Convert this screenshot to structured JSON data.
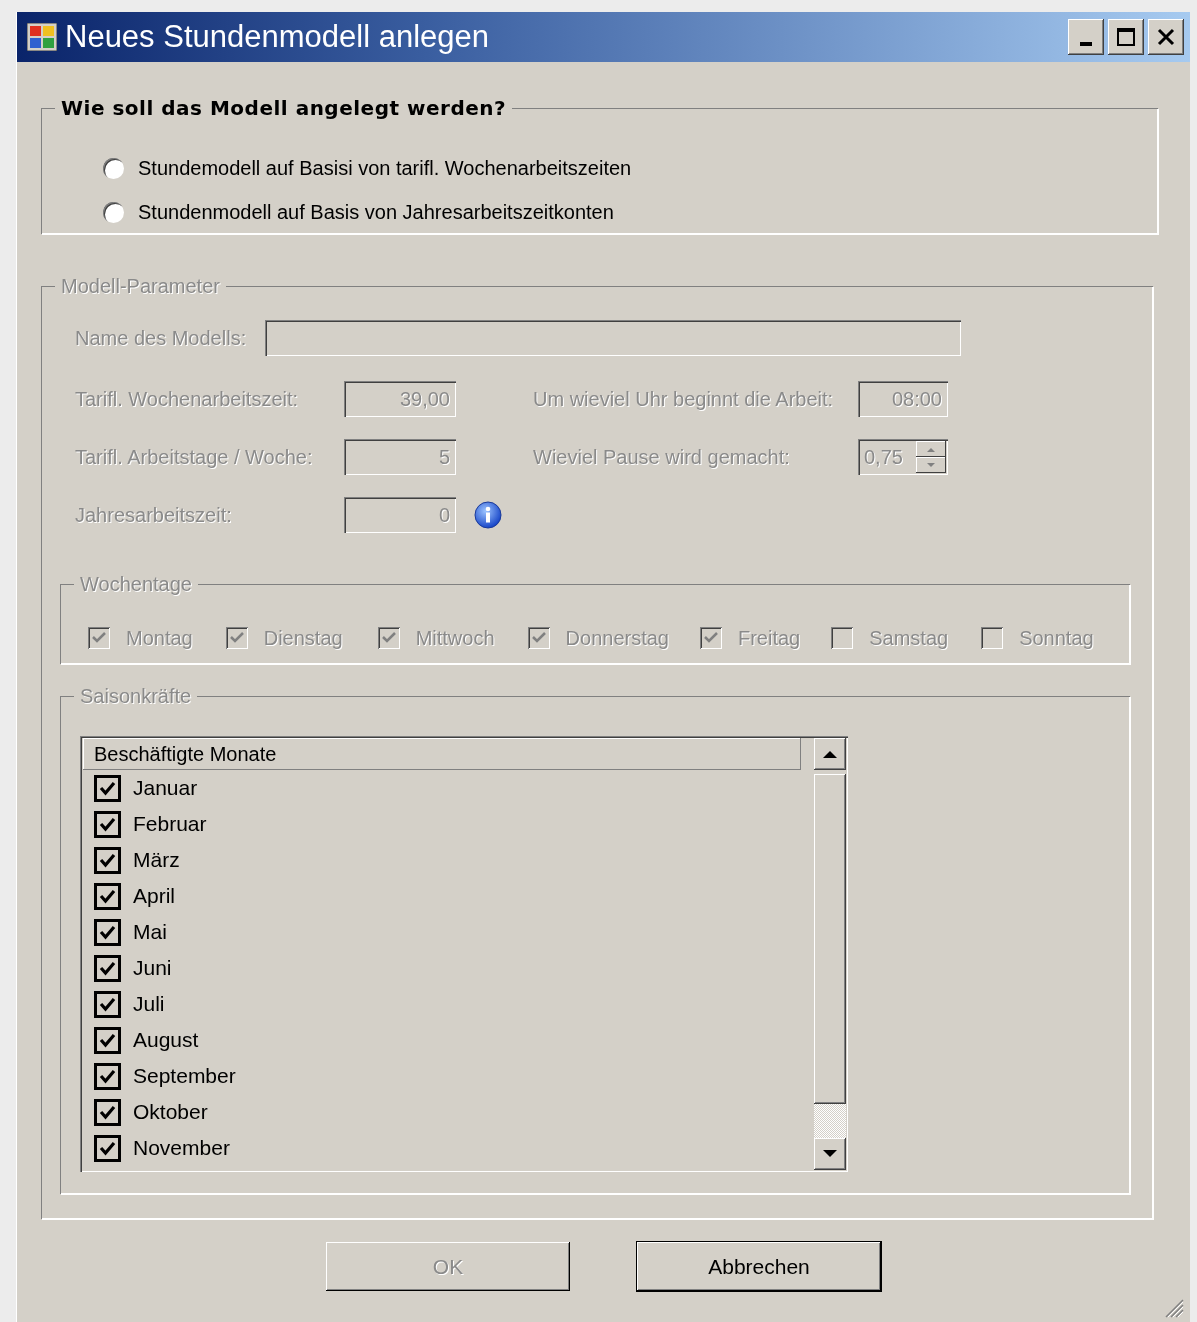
{
  "window": {
    "title": "Neues Stundenmodell anlegen"
  },
  "mode_group": {
    "title": "Wie soll das Modell angelegt werden?",
    "options": [
      {
        "label": "Stundemodell auf Basisi von tarifl. Wochenarbeitszeiten",
        "selected": false
      },
      {
        "label": "Stundenmodell auf Basis von Jahresarbeitszeitkonten",
        "selected": false
      }
    ]
  },
  "parameters": {
    "title": "Modell-Parameter",
    "disabled": true,
    "name_field": {
      "label": "Name des Modells:"
    },
    "weekly_hours": {
      "label": "Tarifl. Wochenarbeitszeit:",
      "value": "39,00"
    },
    "start_time": {
      "label": "Um wieviel Uhr beginnt die Arbeit:",
      "value": "08:00"
    },
    "work_days": {
      "label": "Tarifl. Arbeitstage / Woche:",
      "value": "5"
    },
    "break_time": {
      "label": "Wieviel Pause wird gemacht:",
      "value": "0,75"
    },
    "annual_hours": {
      "label": "Jahresarbeitszeit:",
      "value": "0"
    },
    "weekdays": {
      "title": "Wochentage",
      "days": [
        {
          "label": "Montag",
          "checked": true
        },
        {
          "label": "Dienstag",
          "checked": true
        },
        {
          "label": "Mittwoch",
          "checked": true
        },
        {
          "label": "Donnerstag",
          "checked": true
        },
        {
          "label": "Freitag",
          "checked": true
        },
        {
          "label": "Samstag",
          "checked": false
        },
        {
          "label": "Sonntag",
          "checked": false
        }
      ]
    },
    "seasonal": {
      "title": "Saisonkräfte",
      "column": "Beschäftigte Monate",
      "months": [
        {
          "label": "Januar",
          "checked": true
        },
        {
          "label": "Februar",
          "checked": true
        },
        {
          "label": "März",
          "checked": true
        },
        {
          "label": "April",
          "checked": true
        },
        {
          "label": "Mai",
          "checked": true
        },
        {
          "label": "Juni",
          "checked": true
        },
        {
          "label": "Juli",
          "checked": true
        },
        {
          "label": "August",
          "checked": true
        },
        {
          "label": "September",
          "checked": true
        },
        {
          "label": "Oktober",
          "checked": true
        },
        {
          "label": "November",
          "checked": true
        }
      ]
    }
  },
  "buttons": [
    {
      "label": "OK",
      "disabled": true
    },
    {
      "label": "Abbrechen",
      "disabled": false
    }
  ]
}
